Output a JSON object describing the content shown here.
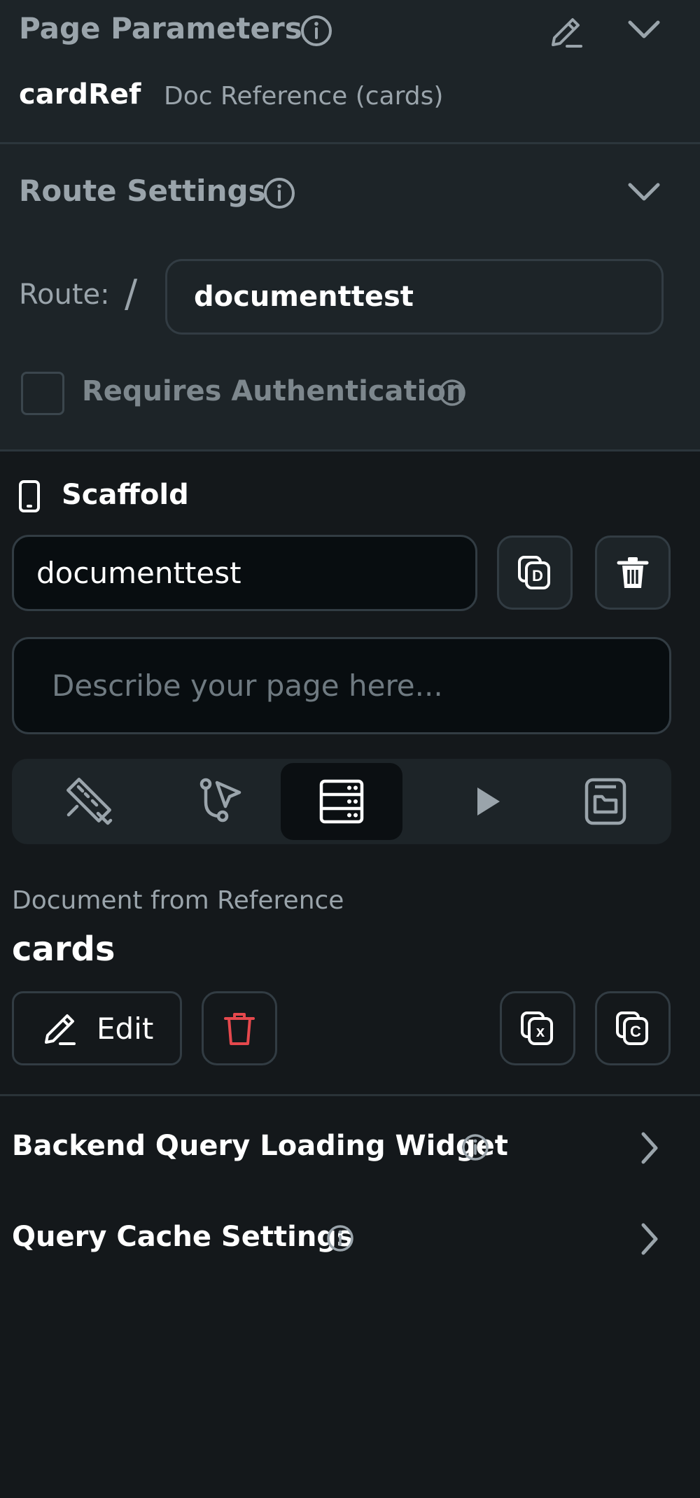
{
  "page_parameters": {
    "title": "Page Parameters",
    "param_name": "cardRef",
    "param_type": "Doc Reference (cards)"
  },
  "route_settings": {
    "title": "Route Settings",
    "route_label": "Route:",
    "route_slash": "/",
    "route_value": "documenttest",
    "requires_auth_label": "Requires Authentication"
  },
  "scaffold": {
    "title": "Scaffold",
    "page_name": "documenttest",
    "description_placeholder": "Describe your page here..."
  },
  "tabs": [
    {
      "name": "properties",
      "icon": "ruler-pencil-icon",
      "active": false
    },
    {
      "name": "actions",
      "icon": "flow-cursor-icon",
      "active": false
    },
    {
      "name": "backend-query",
      "icon": "database-icon",
      "active": true
    },
    {
      "name": "play",
      "icon": "play-icon",
      "active": false
    },
    {
      "name": "folder",
      "icon": "folder-icon",
      "active": false
    }
  ],
  "backend_query": {
    "section_label": "Document from Reference",
    "collection": "cards",
    "edit_label": "Edit",
    "loading_widget_label": "Backend Query Loading Widget",
    "cache_settings_label": "Query Cache Settings"
  },
  "colors": {
    "panel_upper": "#1d2428",
    "panel_lower": "#14181b",
    "muted_text": "#9aa4ab",
    "delete_red": "#e5484d"
  }
}
